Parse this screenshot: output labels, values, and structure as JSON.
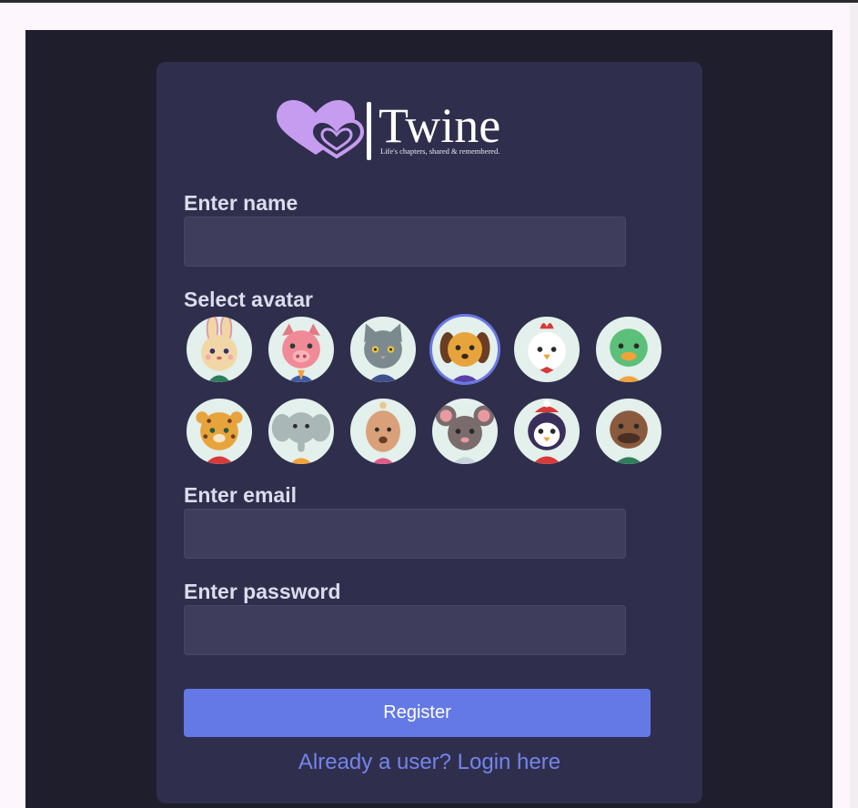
{
  "logo": {
    "brand": "Twine",
    "tagline": "Life's chapters, shared & remembered."
  },
  "form": {
    "name_label": "Enter name",
    "name_value": "",
    "avatar_label": "Select avatar",
    "email_label": "Enter email",
    "email_value": "",
    "password_label": "Enter password",
    "password_value": "",
    "register_label": "Register",
    "login_link": "Already a user? Login here"
  },
  "avatars": [
    {
      "name": "bunny",
      "selected": false
    },
    {
      "name": "pig",
      "selected": false
    },
    {
      "name": "cat",
      "selected": false
    },
    {
      "name": "dog",
      "selected": true
    },
    {
      "name": "chicken",
      "selected": false
    },
    {
      "name": "duck",
      "selected": false
    },
    {
      "name": "leopard",
      "selected": false
    },
    {
      "name": "elephant",
      "selected": false
    },
    {
      "name": "hedgehog",
      "selected": false
    },
    {
      "name": "mouse",
      "selected": false
    },
    {
      "name": "penguin",
      "selected": false
    },
    {
      "name": "platypus",
      "selected": false
    }
  ],
  "colors": {
    "page_bg": "#1f1e2c",
    "card_bg": "#2f2f4d",
    "input_bg": "#3e3e5c",
    "accent": "#6479e6",
    "link": "#7484ec",
    "logo_purple": "#c69cf0"
  }
}
